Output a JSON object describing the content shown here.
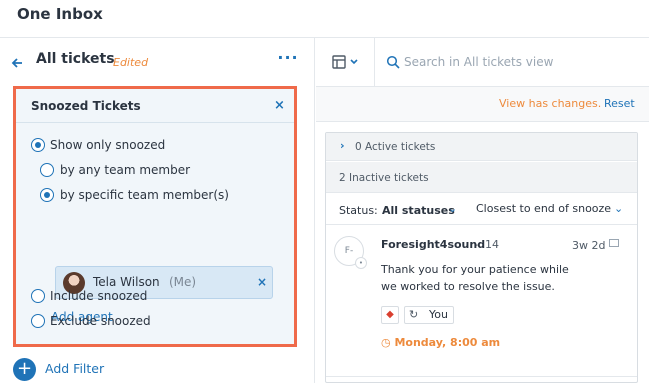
{
  "app": {
    "title": "One Inbox"
  },
  "view": {
    "back_icon": "arrow-left-icon",
    "title": "All tickets",
    "edited": "Edited",
    "more": "···"
  },
  "filter": {
    "title": "Snoozed Tickets",
    "close": "×",
    "options": {
      "show_only": "Show only snoozed",
      "by_any": "by any team member",
      "by_specific": "by specific team member(s)",
      "include": "Include snoozed",
      "exclude": "Exclude snoozed"
    },
    "selected": "show_only",
    "sub_selected": "by_specific",
    "agent": {
      "name": "Tela Wilson",
      "me": "(Me)",
      "remove": "×"
    },
    "add_agent": "Add agent"
  },
  "add_filter": {
    "icon": "+",
    "label": "Add Filter"
  },
  "toolbar": {
    "view_icon": "layout-icon",
    "search_placeholder": "Search in All tickets view"
  },
  "changes": {
    "text": "View has changes.",
    "reset": "Reset"
  },
  "list": {
    "active_label": "0 Active tickets",
    "inactive_label": "2 Inactive tickets",
    "status_key": "Status:",
    "status_value": "All statuses",
    "sort_value": "Closest to end of snooze"
  },
  "ticket": {
    "avatar": "F-",
    "name": "Foresight4sound",
    "dash": "-",
    "id": "14",
    "time": "3w 2d",
    "message": "Thank you for your patience while we worked to resolve the issue.",
    "priority_icon": "◆",
    "assignee": "You",
    "snooze": "Monday, 8:00 am"
  },
  "colors": {
    "accent": "#1f73b7",
    "highlight_border": "#ef6a4a",
    "warning": "#ed8a3c"
  }
}
